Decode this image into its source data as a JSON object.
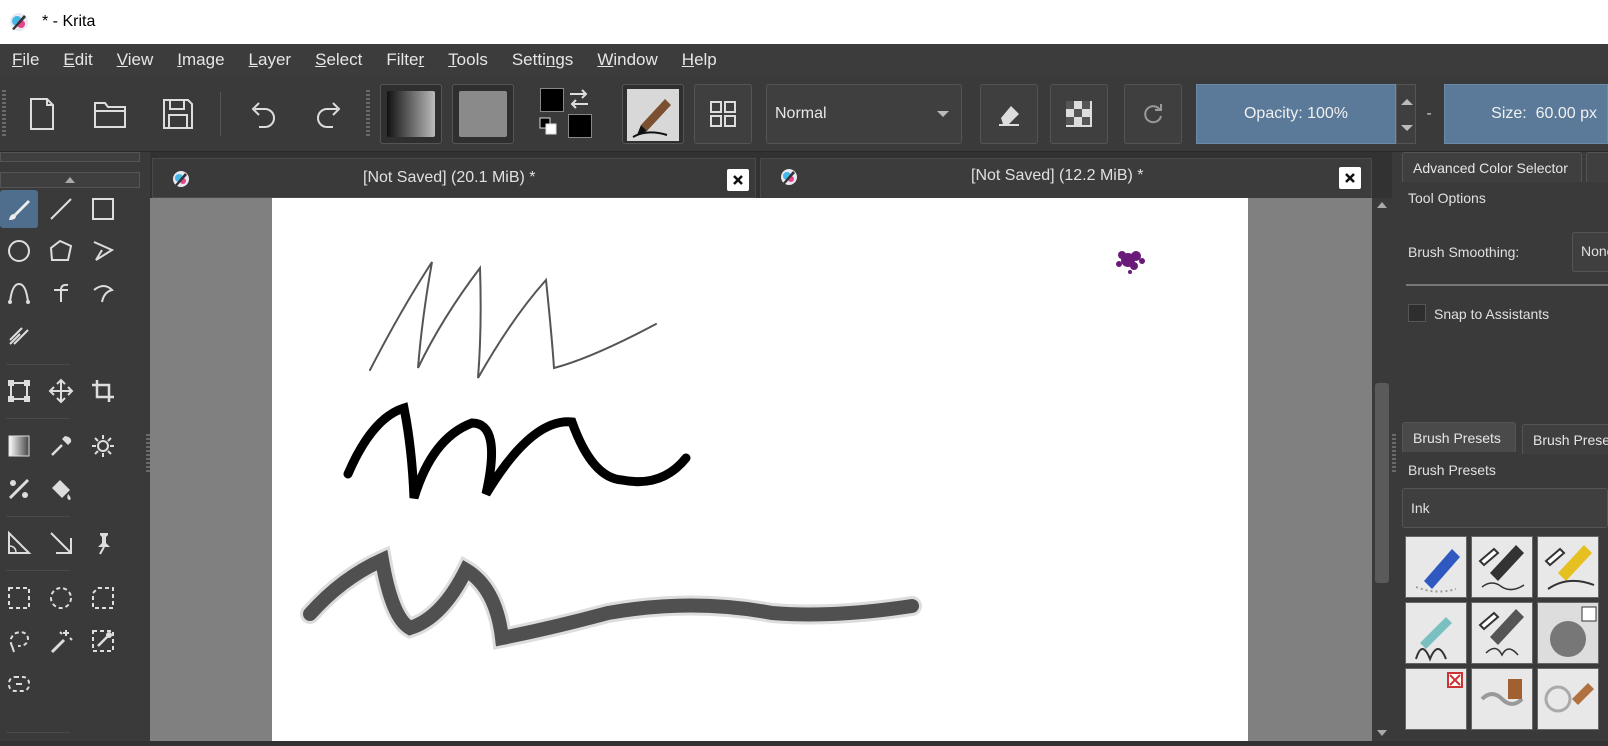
{
  "window": {
    "title": "* - Krita"
  },
  "menu": [
    {
      "pre": "",
      "ul": "F",
      "post": "ile"
    },
    {
      "pre": "",
      "ul": "E",
      "post": "dit"
    },
    {
      "pre": "",
      "ul": "V",
      "post": "iew"
    },
    {
      "pre": "",
      "ul": "I",
      "post": "mage"
    },
    {
      "pre": "",
      "ul": "L",
      "post": "ayer"
    },
    {
      "pre": "",
      "ul": "S",
      "post": "elect"
    },
    {
      "pre": "Filte",
      "ul": "r",
      "post": ""
    },
    {
      "pre": "",
      "ul": "T",
      "post": "ools"
    },
    {
      "pre": "Setti",
      "ul": "n",
      "post": "gs"
    },
    {
      "pre": "",
      "ul": "W",
      "post": "indow"
    },
    {
      "pre": "",
      "ul": "H",
      "post": "elp"
    }
  ],
  "toolbar": {
    "blend_mode": "Normal",
    "opacity_label": "Opacity:",
    "opacity_value": "100%",
    "dash": "-",
    "size_label": "Size:",
    "size_value": "60.00 px"
  },
  "documents": [
    {
      "label": "[Not Saved]  (20.1 MiB) *"
    },
    {
      "label": "[Not Saved]  (12.2 MiB) *"
    }
  ],
  "docker": {
    "tab_color": "Advanced Color Selector",
    "tab_color_ul": "A",
    "tool_options_title": "Tool Options",
    "brush_smoothing_label": "Brush Smoothing:",
    "brush_smoothing_value": "None",
    "snap_label": "Snap to Assistants",
    "presets_tab1": "Brush Presets",
    "presets_tab2": "Brush Prese",
    "presets_title": "Brush Presets",
    "preset_filter": "Ink"
  },
  "colors": {
    "accent": "#5b7a99",
    "active_tool": "#4f6d8c",
    "cursor_blot": "#6a1b7a"
  }
}
